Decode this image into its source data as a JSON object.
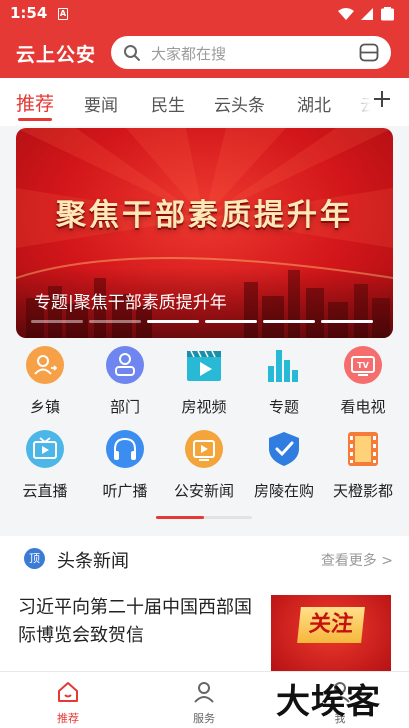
{
  "status_bar": {
    "time": "1:54",
    "sim_label": "A",
    "icons": [
      "wifi-icon",
      "signal-icon",
      "battery-icon"
    ]
  },
  "app_bar": {
    "brand": "云上公安",
    "search_placeholder": "大家都在搜",
    "accent_color": "#e53935"
  },
  "tabs": {
    "items": [
      "推荐",
      "要闻",
      "民生",
      "云头条",
      "湖北",
      "云"
    ],
    "active_index": 0,
    "add_icon": "plus-icon"
  },
  "banner": {
    "headline": "聚焦干部素质提升年",
    "caption": "专题|聚焦干部素质提升年",
    "slide_count": 6,
    "active_slide": 2
  },
  "quick_grid": {
    "items": [
      {
        "label": "乡镇",
        "icon": "township-icon"
      },
      {
        "label": "部门",
        "icon": "department-icon"
      },
      {
        "label": "房视频",
        "icon": "video-icon"
      },
      {
        "label": "专题",
        "icon": "topic-chart-icon"
      },
      {
        "label": "看电视",
        "icon": "tv-icon"
      },
      {
        "label": "云直播",
        "icon": "live-tv-icon"
      },
      {
        "label": "听广播",
        "icon": "headphones-icon"
      },
      {
        "label": "公安新闻",
        "icon": "police-news-icon"
      },
      {
        "label": "房陵在购",
        "icon": "shield-check-icon"
      },
      {
        "label": "天橙影都",
        "icon": "film-icon"
      }
    ],
    "page_count": 2,
    "active_page": 0
  },
  "headline_news": {
    "badge": "顶",
    "title": "头条新闻",
    "more": "查看更多 >",
    "first_item": {
      "title": "习近平向第二十届中国西部国际博览会致贺信",
      "thumb_text": "关注"
    }
  },
  "bottom_nav": {
    "items": [
      {
        "label": "推荐",
        "icon": "home-icon",
        "active": true
      },
      {
        "label": "服务",
        "icon": "user-service-icon",
        "active": false
      },
      {
        "label": "我",
        "icon": "profile-icon",
        "active": false
      }
    ]
  },
  "watermark": "大埃客"
}
